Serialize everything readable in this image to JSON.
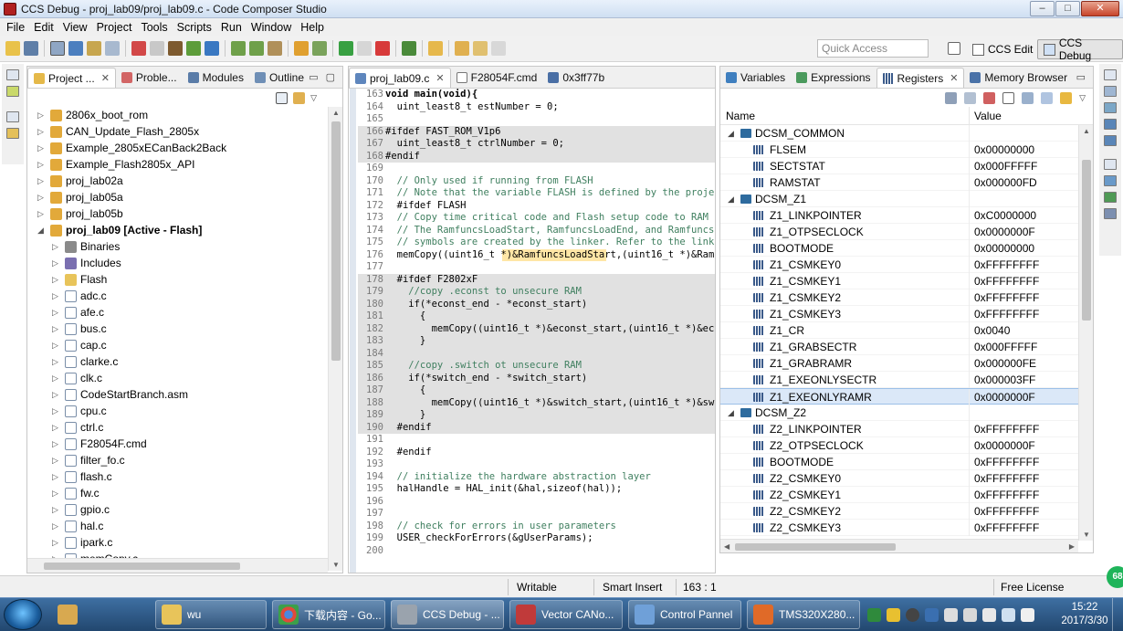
{
  "window": {
    "title": "CCS Debug - proj_lab09/proj_lab09.c - Code Composer Studio",
    "minimize": "–",
    "maximize": "□",
    "close": "✕"
  },
  "menu": [
    "File",
    "Edit",
    "View",
    "Project",
    "Tools",
    "Scripts",
    "Run",
    "Window",
    "Help"
  ],
  "toolbar": {
    "quick_access_placeholder": "Quick Access",
    "perspective_edit": "CCS Edit",
    "perspective_debug": "CCS Debug"
  },
  "project_explorer": {
    "tabs": [
      {
        "label": "Project ...",
        "icon": "project-explorer-icon"
      },
      {
        "label": "Proble...",
        "icon": "problems-icon"
      },
      {
        "label": "Modules",
        "icon": "modules-icon"
      },
      {
        "label": "Outline",
        "icon": "outline-icon"
      }
    ],
    "items": [
      {
        "label": "2806x_boot_rom",
        "level": 0,
        "type": "project"
      },
      {
        "label": "CAN_Update_Flash_2805x",
        "level": 0,
        "type": "project"
      },
      {
        "label": "Example_2805xECanBack2Back",
        "level": 0,
        "type": "project"
      },
      {
        "label": "Example_Flash2805x_API",
        "level": 0,
        "type": "project"
      },
      {
        "label": "proj_lab02a",
        "level": 0,
        "type": "project"
      },
      {
        "label": "proj_lab05a",
        "level": 0,
        "type": "project"
      },
      {
        "label": "proj_lab05b",
        "level": 0,
        "type": "project"
      },
      {
        "label": "proj_lab09  [Active - Flash]",
        "level": 0,
        "type": "project",
        "bold": true,
        "expanded": true
      },
      {
        "label": "Binaries",
        "level": 1,
        "type": "binaries"
      },
      {
        "label": "Includes",
        "level": 1,
        "type": "includes"
      },
      {
        "label": "Flash",
        "level": 1,
        "type": "folder"
      },
      {
        "label": "adc.c",
        "level": 1,
        "type": "file"
      },
      {
        "label": "afe.c",
        "level": 1,
        "type": "file"
      },
      {
        "label": "bus.c",
        "level": 1,
        "type": "file"
      },
      {
        "label": "cap.c",
        "level": 1,
        "type": "file"
      },
      {
        "label": "clarke.c",
        "level": 1,
        "type": "file"
      },
      {
        "label": "clk.c",
        "level": 1,
        "type": "file"
      },
      {
        "label": "CodeStartBranch.asm",
        "level": 1,
        "type": "file"
      },
      {
        "label": "cpu.c",
        "level": 1,
        "type": "file"
      },
      {
        "label": "ctrl.c",
        "level": 1,
        "type": "file"
      },
      {
        "label": "F28054F.cmd",
        "level": 1,
        "type": "file"
      },
      {
        "label": "filter_fo.c",
        "level": 1,
        "type": "file"
      },
      {
        "label": "flash.c",
        "level": 1,
        "type": "file"
      },
      {
        "label": "fw.c",
        "level": 1,
        "type": "file"
      },
      {
        "label": "gpio.c",
        "level": 1,
        "type": "file"
      },
      {
        "label": "hal.c",
        "level": 1,
        "type": "file"
      },
      {
        "label": "ipark.c",
        "level": 1,
        "type": "file"
      },
      {
        "label": "memCopy.c",
        "level": 1,
        "type": "file"
      }
    ]
  },
  "editor": {
    "tabs": [
      {
        "label": "proj_lab09.c",
        "icon": "c-file-icon"
      },
      {
        "label": "F28054F.cmd",
        "icon": "cmd-file-icon"
      },
      {
        "label": "0x3ff77b",
        "icon": "disassembly-icon"
      }
    ],
    "lines": [
      {
        "n": "163",
        "text": "void main(void){",
        "style": "kw"
      },
      {
        "n": "164",
        "text": "  uint_least8_t estNumber = 0;"
      },
      {
        "n": "165",
        "text": ""
      },
      {
        "n": "166",
        "text": "#ifdef FAST_ROM_V1p6",
        "gray": true
      },
      {
        "n": "167",
        "text": "  uint_least8_t ctrlNumber = 0;",
        "gray": true
      },
      {
        "n": "168",
        "text": "#endif",
        "gray": true,
        "style": "pp"
      },
      {
        "n": "169",
        "text": ""
      },
      {
        "n": "170",
        "text": "  // Only used if running from FLASH",
        "style": "cmt"
      },
      {
        "n": "171",
        "text": "  // Note that the variable FLASH is defined by the projec",
        "style": "cmt"
      },
      {
        "n": "172",
        "text": "  #ifdef FLASH"
      },
      {
        "n": "173",
        "text": "  // Copy time critical code and Flash setup code to RAM",
        "style": "cmt"
      },
      {
        "n": "174",
        "text": "  // The RamfuncsLoadStart, RamfuncsLoadEnd, and RamfuncsR",
        "style": "cmt"
      },
      {
        "n": "175",
        "text": "  // symbols are created by the linker. Refer to the linke",
        "style": "cmt"
      },
      {
        "n": "176",
        "text": "  memCopy((uint16_t *)&RamfuncsLoadStart,(uint16_t *)&Ram",
        "style": "hl"
      },
      {
        "n": "177",
        "text": ""
      },
      {
        "n": "178",
        "text": "  #ifdef F2802xF",
        "gray": true
      },
      {
        "n": "179",
        "text": "    //copy .econst to unsecure RAM",
        "gray": true,
        "style": "cmt"
      },
      {
        "n": "180",
        "text": "    if(*econst_end - *econst_start)",
        "gray": true
      },
      {
        "n": "181",
        "text": "      {",
        "gray": true
      },
      {
        "n": "182",
        "text": "        memCopy((uint16_t *)&econst_start,(uint16_t *)&eco",
        "gray": true
      },
      {
        "n": "183",
        "text": "      }",
        "gray": true
      },
      {
        "n": "184",
        "text": "",
        "gray": true
      },
      {
        "n": "185",
        "text": "    //copy .switch ot unsecure RAM",
        "gray": true,
        "style": "cmt"
      },
      {
        "n": "186",
        "text": "    if(*switch_end - *switch_start)",
        "gray": true
      },
      {
        "n": "187",
        "text": "      {",
        "gray": true
      },
      {
        "n": "188",
        "text": "        memCopy((uint16_t *)&switch_start,(uint16_t *)&swi",
        "gray": true
      },
      {
        "n": "189",
        "text": "      }",
        "gray": true
      },
      {
        "n": "190",
        "text": "  #endif",
        "gray": true,
        "style": "pp"
      },
      {
        "n": "191",
        "text": ""
      },
      {
        "n": "192",
        "text": "  #endif",
        "style": "pp"
      },
      {
        "n": "193",
        "text": ""
      },
      {
        "n": "194",
        "text": "  // initialize the hardware abstraction layer",
        "style": "cmt"
      },
      {
        "n": "195",
        "text": "  halHandle = HAL_init(&hal,sizeof(hal));"
      },
      {
        "n": "196",
        "text": ""
      },
      {
        "n": "197",
        "text": ""
      },
      {
        "n": "198",
        "text": "  // check for errors in user parameters",
        "style": "cmt"
      },
      {
        "n": "199",
        "text": "  USER_checkForErrors(&gUserParams);"
      },
      {
        "n": "200",
        "text": ""
      }
    ]
  },
  "registers": {
    "tabs": [
      {
        "label": "Variables",
        "icon": "variables-icon"
      },
      {
        "label": "Expressions",
        "icon": "expressions-icon"
      },
      {
        "label": "Registers",
        "icon": "registers-icon"
      },
      {
        "label": "Memory Browser",
        "icon": "memory-icon"
      }
    ],
    "col_name": "Name",
    "col_value": "Value",
    "rows": [
      {
        "name": "DCSM_COMMON",
        "value": "",
        "group": true
      },
      {
        "name": "FLSEM",
        "value": "0x00000000"
      },
      {
        "name": "SECTSTAT",
        "value": "0x000FFFFF"
      },
      {
        "name": "RAMSTAT",
        "value": "0x000000FD"
      },
      {
        "name": "DCSM_Z1",
        "value": "",
        "group": true
      },
      {
        "name": "Z1_LINKPOINTER",
        "value": "0xC0000000"
      },
      {
        "name": "Z1_OTPSECLOCK",
        "value": "0x0000000F"
      },
      {
        "name": "BOOTMODE",
        "value": "0x00000000"
      },
      {
        "name": "Z1_CSMKEY0",
        "value": "0xFFFFFFFF"
      },
      {
        "name": "Z1_CSMKEY1",
        "value": "0xFFFFFFFF"
      },
      {
        "name": "Z1_CSMKEY2",
        "value": "0xFFFFFFFF"
      },
      {
        "name": "Z1_CSMKEY3",
        "value": "0xFFFFFFFF"
      },
      {
        "name": "Z1_CR",
        "value": "0x0040"
      },
      {
        "name": "Z1_GRABSECTR",
        "value": "0x000FFFFF"
      },
      {
        "name": "Z1_GRABRAMR",
        "value": "0x000000FE"
      },
      {
        "name": "Z1_EXEONLYSECTR",
        "value": "0x000003FF"
      },
      {
        "name": "Z1_EXEONLYRAMR",
        "value": "0x0000000F",
        "selected": true
      },
      {
        "name": "DCSM_Z2",
        "value": "",
        "group": true
      },
      {
        "name": "Z2_LINKPOINTER",
        "value": "0xFFFFFFFF"
      },
      {
        "name": "Z2_OTPSECLOCK",
        "value": "0x0000000F"
      },
      {
        "name": "BOOTMODE",
        "value": "0xFFFFFFFF"
      },
      {
        "name": "Z2_CSMKEY0",
        "value": "0xFFFFFFFF"
      },
      {
        "name": "Z2_CSMKEY1",
        "value": "0xFFFFFFFF"
      },
      {
        "name": "Z2_CSMKEY2",
        "value": "0xFFFFFFFF"
      },
      {
        "name": "Z2_CSMKEY3",
        "value": "0xFFFFFFFF"
      }
    ]
  },
  "statusbar": {
    "mode": "Writable",
    "insert": "Smart Insert",
    "position": "163 : 1",
    "license": "Free License"
  },
  "taskbar": {
    "items": [
      {
        "label": "",
        "icon": "paint-icon",
        "pinned": true
      },
      {
        "label": "wu",
        "icon": "folder-icon"
      },
      {
        "label": "下载内容 - Go...",
        "icon": "chrome-icon"
      },
      {
        "label": "CCS Debug - ...",
        "icon": "ccs-icon"
      },
      {
        "label": "Vector CANo...",
        "icon": "vector-icon"
      },
      {
        "label": "Control Pannel",
        "icon": "control-panel-icon"
      },
      {
        "label": "TMS320X280...",
        "icon": "pdf-icon"
      }
    ],
    "time": "15:22",
    "date": "2017/3/30",
    "badge": "68"
  },
  "colors": {
    "accent": "#3875d7",
    "comment": "#3f7f5f",
    "keyword": "#7f0055",
    "inactive_code_bg": "#e1e1e1",
    "selection": "#dbe8f8"
  }
}
